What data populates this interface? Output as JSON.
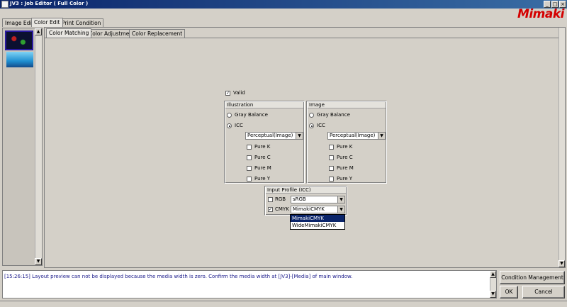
{
  "window": {
    "title": "JV3 : Job Editor ( Full Color )"
  },
  "logo": "Mimaki",
  "main_tabs": [
    "Image Edit",
    "Color Edit",
    "Print Condition"
  ],
  "sub_tabs": [
    "Color Matching",
    "Color Adjustment",
    "Color Replacement"
  ],
  "valid_label": "Valid",
  "illustration": {
    "title": "Illustration",
    "gray_balance": "Gray Balance",
    "icc": "ICC",
    "intent": "Perceptual(Image)",
    "pure_k": "Pure K",
    "pure_c": "Pure C",
    "pure_m": "Pure M",
    "pure_y": "Pure Y"
  },
  "image": {
    "title": "Image",
    "gray_balance": "Gray Balance",
    "icc": "ICC",
    "intent": "Perceptual(Image)",
    "pure_k": "Pure K",
    "pure_c": "Pure C",
    "pure_m": "Pure M",
    "pure_y": "Pure Y"
  },
  "input_profile": {
    "title": "Input Profile (ICC)",
    "rgb_label": "RGB",
    "rgb_value": "sRGB",
    "cmyk_label": "CMYK",
    "cmyk_value": "MimakiCMYK",
    "options": [
      "MimakiCMYK",
      "WideMimakiCMYK"
    ]
  },
  "message": "[15:26:15] Layout preview can not be displayed because the media width is zero. Confirm the media width at [JV3]-[Media] of main window.",
  "buttons": {
    "condition_management": "Condition Management",
    "ok": "OK",
    "cancel": "Cancel"
  }
}
